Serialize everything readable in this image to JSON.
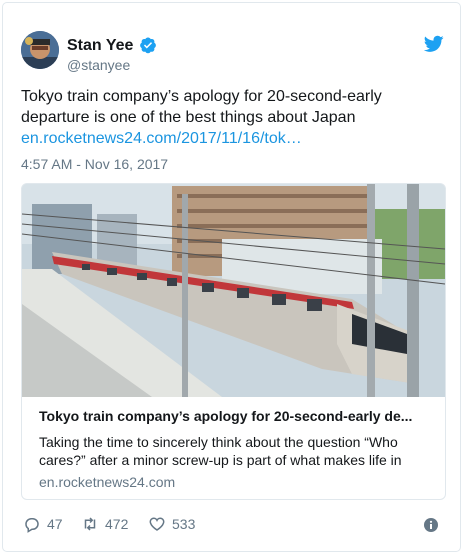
{
  "tweet": {
    "author_name": "Stan Yee",
    "handle": "@stanyee",
    "text": "Tokyo train company’s apology for 20-second-early departure is one of the best things about Japan",
    "link": "en.rocketnews24.com/2017/11/16/tok…",
    "timestamp": "4:57 AM - Nov 16, 2017",
    "verified": true
  },
  "card": {
    "title": "Tokyo train company’s apology for 20-second-early de...",
    "description": "Taking the time to sincerely think about the question “Who cares?” after a minor screw-up is part of what makes life in",
    "domain": "en.rocketnews24.com"
  },
  "actions": {
    "replies": "47",
    "retweets": "472",
    "likes": "533"
  },
  "colors": {
    "brand_blue": "#1da1f2",
    "link_blue": "#1b95e0",
    "muted": "#657786",
    "border": "#e1e8ed"
  },
  "icons": [
    "twitter-bird-icon",
    "verified-badge-icon",
    "reply-icon",
    "retweet-icon",
    "like-icon",
    "info-icon"
  ]
}
